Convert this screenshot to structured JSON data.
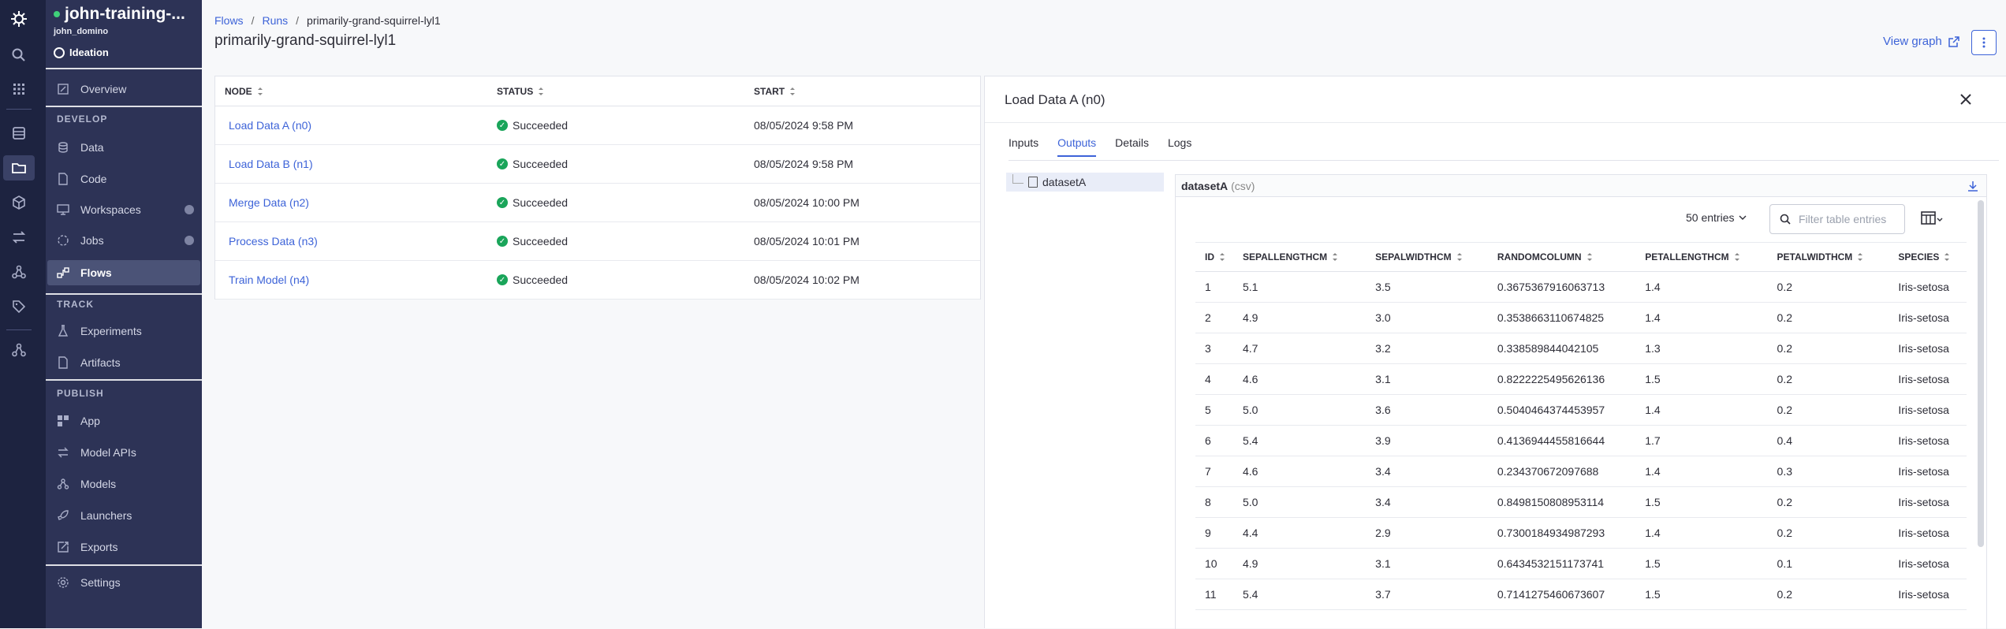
{
  "rail": {
    "icons": [
      "domino-logo-icon",
      "search-icon",
      "apps-grid-icon",
      "database-icon",
      "folder-icon",
      "cube-icon",
      "transfer-icon",
      "model-icon",
      "tag-icon",
      "network-icon"
    ]
  },
  "sidebar": {
    "project_name": "john-training-...",
    "owner": "john_domino",
    "stage": "Ideation",
    "overview": "Overview",
    "develop_label": "DEVELOP",
    "develop_items": [
      "Data",
      "Code",
      "Workspaces",
      "Jobs",
      "Flows"
    ],
    "track_label": "TRACK",
    "track_items": [
      "Experiments",
      "Artifacts"
    ],
    "publish_label": "PUBLISH",
    "publish_items": [
      "App",
      "Model APIs",
      "Models",
      "Launchers",
      "Exports"
    ],
    "settings": "Settings"
  },
  "header": {
    "breadcrumb": [
      "Flows",
      "Runs",
      "primarily-grand-squirrel-lyl1"
    ],
    "title": "primarily-grand-squirrel-lyl1",
    "view_graph": "View graph"
  },
  "nodes_table": {
    "columns": [
      "NODE",
      "STATUS",
      "START"
    ],
    "rows": [
      {
        "node": "Load Data A (n0)",
        "status": "Succeeded",
        "start": "08/05/2024 9:58 PM"
      },
      {
        "node": "Load Data B (n1)",
        "status": "Succeeded",
        "start": "08/05/2024 9:58 PM"
      },
      {
        "node": "Merge Data (n2)",
        "status": "Succeeded",
        "start": "08/05/2024 10:00 PM"
      },
      {
        "node": "Process Data (n3)",
        "status": "Succeeded",
        "start": "08/05/2024 10:01 PM"
      },
      {
        "node": "Train Model (n4)",
        "status": "Succeeded",
        "start": "08/05/2024 10:02 PM"
      }
    ]
  },
  "panel": {
    "title": "Load Data A (n0)",
    "tabs": [
      "Inputs",
      "Outputs",
      "Details",
      "Logs"
    ],
    "active_tab": "Outputs",
    "tree_item": "datasetA",
    "file_name": "datasetA",
    "file_ext": "(csv)",
    "entries": "50 entries",
    "filter_placeholder": "Filter table entries",
    "columns": [
      "ID",
      "SEPALLENGTHCM",
      "SEPALWIDTHCM",
      "RANDOMCOLUMN",
      "PETALLENGTHCM",
      "PETALWIDTHCM",
      "SPECIES"
    ],
    "rows": [
      [
        "1",
        "5.1",
        "3.5",
        "0.3675367916063713",
        "1.4",
        "0.2",
        "Iris-setosa"
      ],
      [
        "2",
        "4.9",
        "3.0",
        "0.3538663110674825",
        "1.4",
        "0.2",
        "Iris-setosa"
      ],
      [
        "3",
        "4.7",
        "3.2",
        "0.338589844042105",
        "1.3",
        "0.2",
        "Iris-setosa"
      ],
      [
        "4",
        "4.6",
        "3.1",
        "0.8222225495626136",
        "1.5",
        "0.2",
        "Iris-setosa"
      ],
      [
        "5",
        "5.0",
        "3.6",
        "0.5040464374453957",
        "1.4",
        "0.2",
        "Iris-setosa"
      ],
      [
        "6",
        "5.4",
        "3.9",
        "0.4136944455816644",
        "1.7",
        "0.4",
        "Iris-setosa"
      ],
      [
        "7",
        "4.6",
        "3.4",
        "0.234370672097688",
        "1.4",
        "0.3",
        "Iris-setosa"
      ],
      [
        "8",
        "5.0",
        "3.4",
        "0.8498150808953114",
        "1.5",
        "0.2",
        "Iris-setosa"
      ],
      [
        "9",
        "4.4",
        "2.9",
        "0.7300184934987293",
        "1.4",
        "0.2",
        "Iris-setosa"
      ],
      [
        "10",
        "4.9",
        "3.1",
        "0.6434532151173741",
        "1.5",
        "0.1",
        "Iris-setosa"
      ],
      [
        "11",
        "5.4",
        "3.7",
        "0.7141275460673607",
        "1.5",
        "0.2",
        "Iris-setosa"
      ]
    ]
  },
  "colors": {
    "accent": "#3d63d8",
    "rail_bg": "#1d2340",
    "sidebar_bg": "#2d3356",
    "success": "#1aa55a"
  }
}
